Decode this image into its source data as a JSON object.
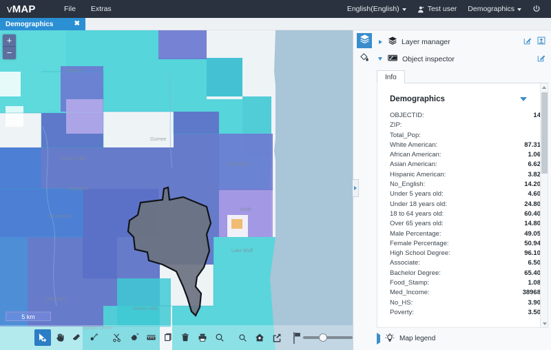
{
  "app": {
    "brand_v": "v",
    "brand_map": "MAP",
    "accent": "#2b8fd4",
    "topbar_bg": "#29323e"
  },
  "menu": [
    {
      "label": "File"
    },
    {
      "label": "Extras"
    }
  ],
  "topbar_right": {
    "language": "English(English)",
    "user": "Test user",
    "project": "Demographics",
    "power_icon": "power-icon",
    "user_icon": "user-icon"
  },
  "tabs": [
    {
      "label": "Demographics",
      "close": "✖"
    }
  ],
  "map": {
    "zoom_in": "+",
    "zoom_out": "−",
    "scale_label": "5 km",
    "selected_feature_color": "#6b7280",
    "water_color": "#a9c5d8",
    "tools": [
      {
        "name": "select-add-tool",
        "active": true
      },
      {
        "name": "pan-hand-tool",
        "active": false
      },
      {
        "name": "eraser-tool",
        "active": false
      },
      {
        "name": "point-tool",
        "active": false
      },
      {
        "name": "cut-scissors-tool",
        "active": false
      },
      {
        "name": "polygon-tool",
        "active": false
      },
      {
        "name": "measure-tool",
        "active": false
      },
      {
        "name": "copy-tool",
        "active": false
      },
      {
        "name": "delete-tool",
        "active": false
      },
      {
        "name": "print-tool",
        "active": false
      },
      {
        "name": "zoom-search-tool",
        "active": false
      },
      {
        "name": "search-tool",
        "active": false
      },
      {
        "name": "home-extent-tool",
        "active": false
      },
      {
        "name": "export-share-tool",
        "active": false
      }
    ],
    "opacity_slider": {
      "name": "opacity-slider",
      "value": 40
    }
  },
  "panel": {
    "icon_layers": "layers-icon",
    "icon_paint": "paint-bucket-icon",
    "rows": [
      {
        "label": "Layer manager",
        "expanded": false,
        "actions": [
          "edit-icon",
          "import-icon"
        ]
      },
      {
        "label": "Object inspector",
        "expanded": true,
        "actions": [
          "edit-icon"
        ]
      }
    ],
    "info_tab": "Info",
    "info_title": "Demographics",
    "attributes": [
      {
        "key": "OBJECTID:",
        "value": "14"
      },
      {
        "key": "ZIP:",
        "value": ""
      },
      {
        "key": "Total_Pop:",
        "value": ""
      },
      {
        "key": "White American:",
        "value": "87.31"
      },
      {
        "key": "African American:",
        "value": "1.06"
      },
      {
        "key": "Asian American:",
        "value": "6.62"
      },
      {
        "key": "Hispanic American:",
        "value": "3.82"
      },
      {
        "key": "No_English:",
        "value": "14.20"
      },
      {
        "key": "Under 5 years old:",
        "value": "4.60"
      },
      {
        "key": "Under 18 years old:",
        "value": "24.80"
      },
      {
        "key": "18 to 64 years old:",
        "value": "60.40"
      },
      {
        "key": "Over 65 years old:",
        "value": "14.80"
      },
      {
        "key": "Male Percentage:",
        "value": "49.05"
      },
      {
        "key": "Female Percentage:",
        "value": "50.94"
      },
      {
        "key": "High School Degree:",
        "value": "96.10"
      },
      {
        "key": "Associate:",
        "value": "6.50"
      },
      {
        "key": "Bachelor Degree:",
        "value": "65.40"
      },
      {
        "key": "Food_Stamp:",
        "value": "1.08"
      },
      {
        "key": "Med_Income:",
        "value": "38968"
      },
      {
        "key": "No_HS:",
        "value": "3.90"
      },
      {
        "key": "Poverty:",
        "value": "3.50"
      }
    ],
    "map_legend": "Map legend",
    "legend_icon": "lightbulb-icon"
  }
}
